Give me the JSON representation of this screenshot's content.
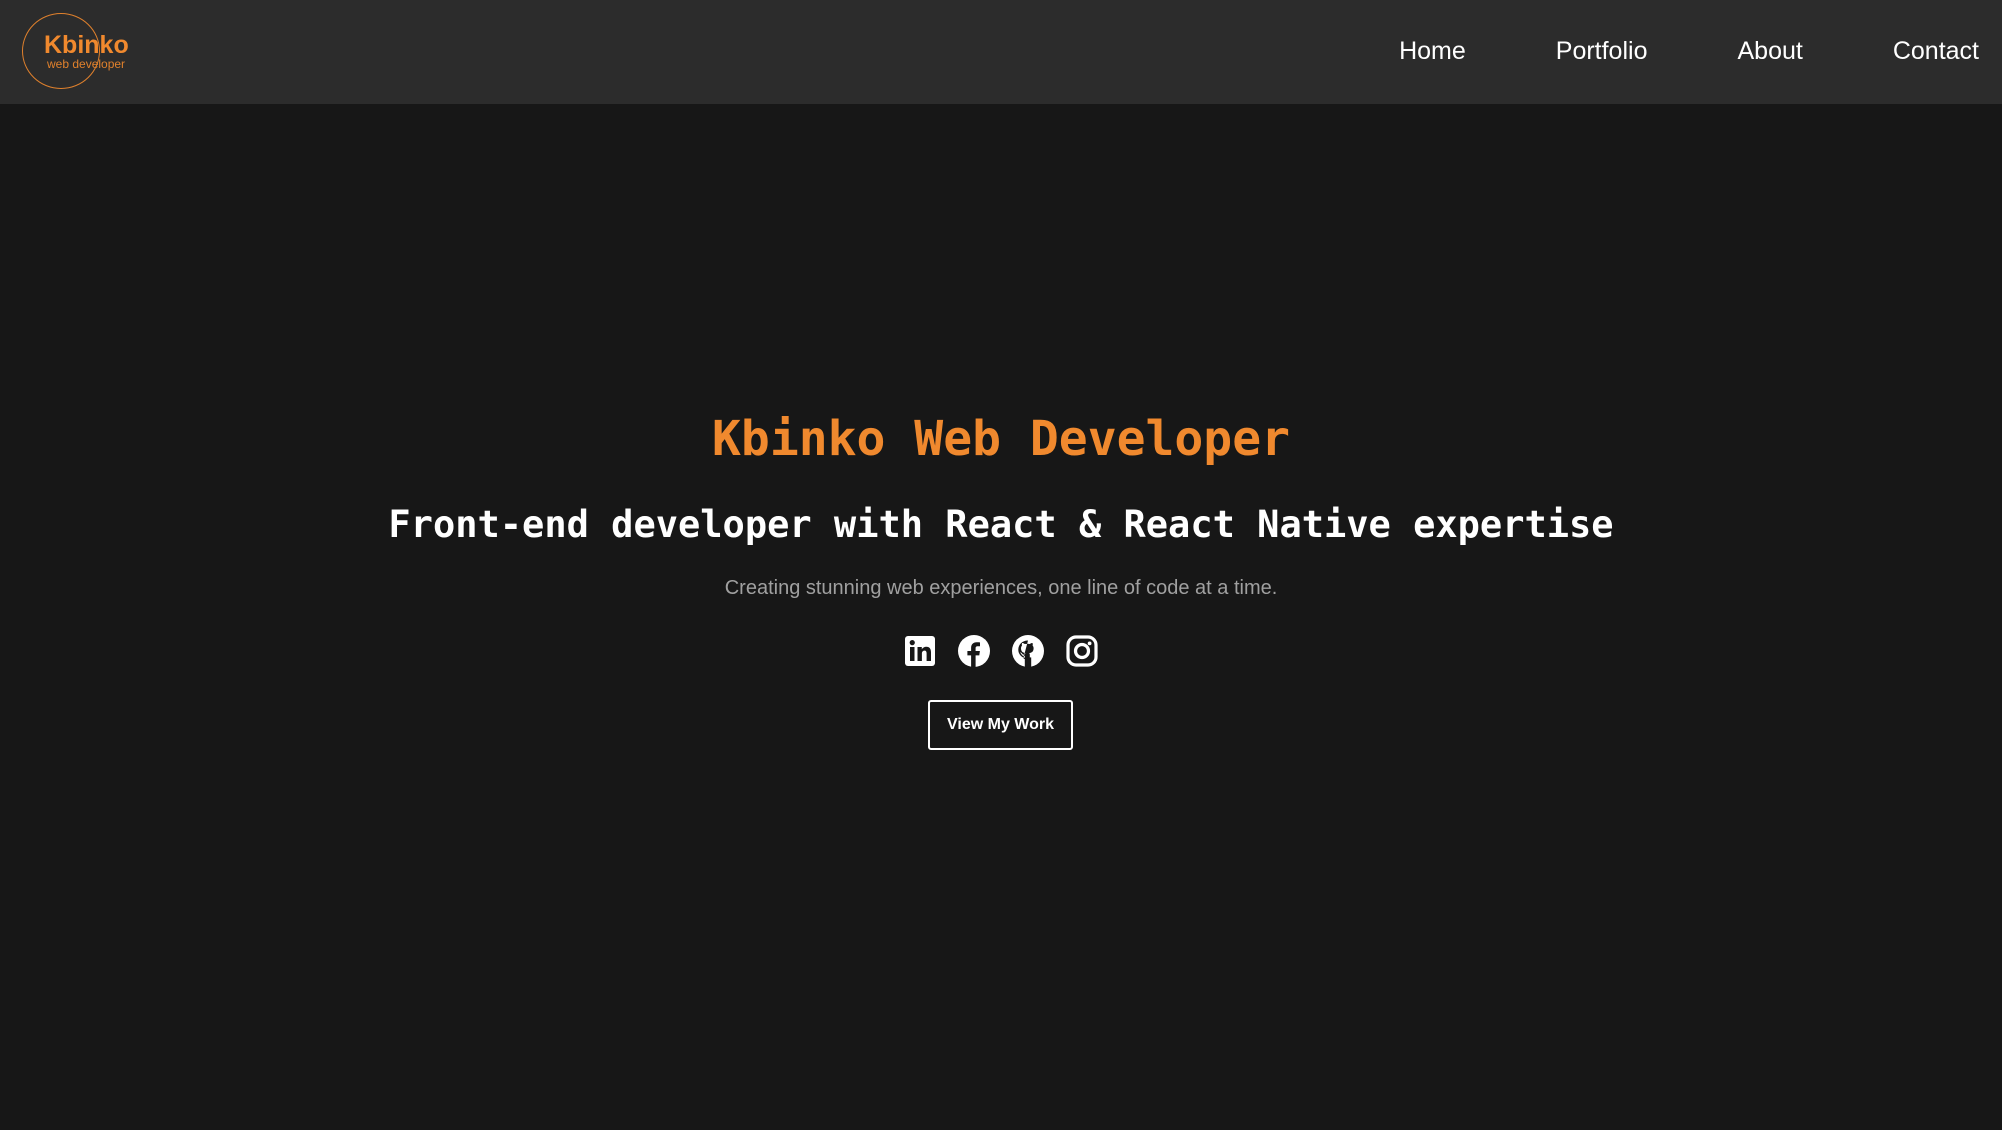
{
  "brand": {
    "name": "Kbinko",
    "tagline": "web developer",
    "accent_color": "#f0892e"
  },
  "nav": {
    "items": [
      {
        "label": "Home"
      },
      {
        "label": "Portfolio"
      },
      {
        "label": "About"
      },
      {
        "label": "Contact"
      }
    ]
  },
  "hero": {
    "title": "Kbinko Web Developer",
    "subtitle": "Front-end developer with React & React Native expertise",
    "tagline": "Creating stunning web experiences, one line of code at a time.",
    "cta_label": "View My Work",
    "socials": [
      {
        "icon": "linkedin-icon"
      },
      {
        "icon": "facebook-icon"
      },
      {
        "icon": "github-icon"
      },
      {
        "icon": "instagram-icon"
      }
    ]
  },
  "colors": {
    "header_bg": "#2c2c2c",
    "page_bg": "#171717",
    "text": "#ffffff",
    "muted_text": "#a0a0a0"
  }
}
